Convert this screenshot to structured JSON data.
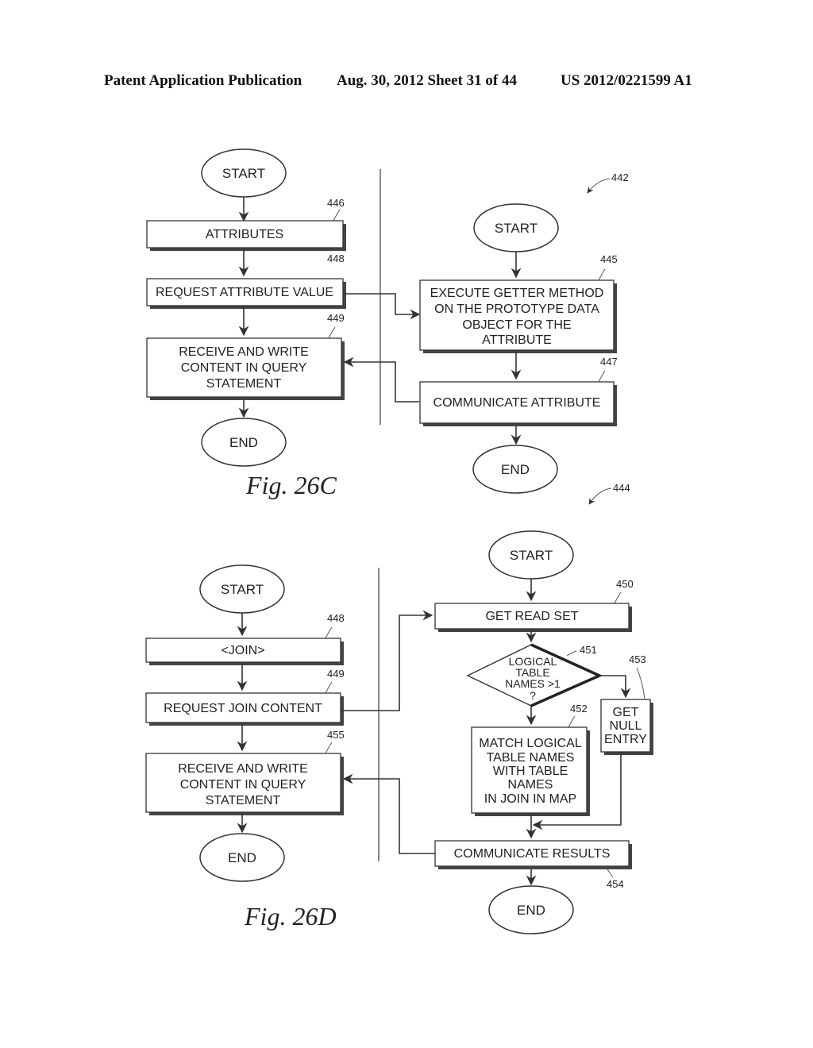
{
  "header": {
    "publication": "Patent Application Publication",
    "date_sheet": "Aug. 30, 2012  Sheet 31 of 44",
    "pub_number": "US 2012/0221599 A1"
  },
  "fig26c": {
    "caption": "Fig. 26C",
    "left": {
      "start": "START",
      "end": "END",
      "steps": [
        {
          "ref": "446",
          "lines": [
            "ATTRIBUTES"
          ]
        },
        {
          "ref": "448",
          "lines": [
            "REQUEST ATTRIBUTE VALUE"
          ]
        },
        {
          "ref": "449",
          "lines": [
            "RECEIVE AND WRITE",
            "CONTENT IN QUERY",
            "STATEMENT"
          ]
        }
      ]
    },
    "right": {
      "group_ref": "442",
      "start": "START",
      "end": "END",
      "steps": [
        {
          "ref": "445",
          "lines": [
            "EXECUTE GETTER METHOD",
            "ON THE PROTOTYPE DATA",
            "OBJECT FOR THE",
            "ATTRIBUTE"
          ]
        },
        {
          "ref": "447",
          "lines": [
            "COMMUNICATE ATTRIBUTE"
          ]
        }
      ]
    }
  },
  "fig26d": {
    "caption": "Fig. 26D",
    "left": {
      "start": "START",
      "end": "END",
      "steps": [
        {
          "ref": "448",
          "lines": [
            "<JOIN>"
          ]
        },
        {
          "ref": "449",
          "lines": [
            "REQUEST JOIN CONTENT"
          ]
        },
        {
          "ref": "455",
          "lines": [
            "RECEIVE AND WRITE",
            "CONTENT IN QUERY",
            "STATEMENT"
          ]
        }
      ]
    },
    "right": {
      "group_ref": "444",
      "start": "START",
      "end": "END",
      "steps": [
        {
          "ref": "450",
          "lines": [
            "GET READ SET"
          ]
        },
        {
          "ref": "451",
          "lines": [
            "LOGICAL",
            "TABLE",
            "NAMES >1",
            "?"
          ]
        },
        {
          "ref": "452",
          "lines": [
            "MATCH LOGICAL",
            "TABLE NAMES",
            "WITH TABLE",
            "NAMES",
            "IN JOIN IN MAP"
          ]
        },
        {
          "ref": "453",
          "lines": [
            "GET",
            "NULL",
            "ENTRY"
          ]
        },
        {
          "ref": "454",
          "lines": [
            "COMMUNICATE RESULTS"
          ]
        }
      ]
    }
  }
}
